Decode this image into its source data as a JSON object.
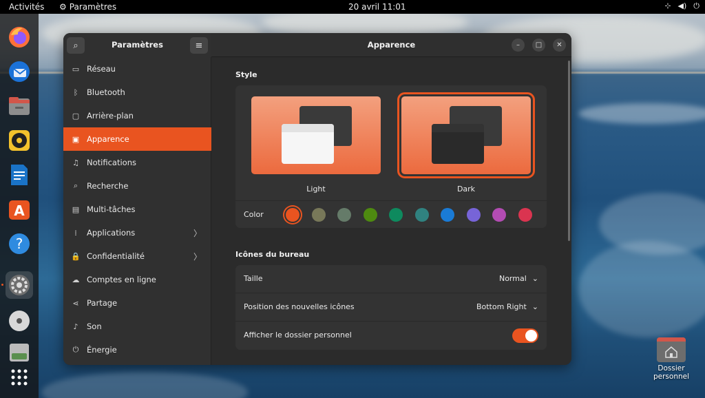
{
  "topbar": {
    "activities": "Activités",
    "app_name": "Paramètres",
    "clock": "20 avril  11:01"
  },
  "dock": {
    "items": [
      "firefox-icon",
      "thunderbird-icon",
      "files-icon",
      "rhythmbox-icon",
      "writer-icon",
      "app-center-icon",
      "help-icon",
      "settings-icon",
      "disc-icon",
      "drive-icon",
      "app-grid-icon"
    ]
  },
  "window": {
    "sidebar_title": "Paramètres",
    "main_title": "Apparence",
    "nav": [
      {
        "label": "Réseau",
        "icon": "network-icon",
        "glyph": "▭",
        "chevron": ""
      },
      {
        "label": "Bluetooth",
        "icon": "bluetooth-icon",
        "glyph": "ᛒ",
        "chevron": ""
      },
      {
        "label": "Arrière-plan",
        "icon": "background-icon",
        "glyph": "▢",
        "chevron": ""
      },
      {
        "label": "Apparence",
        "icon": "appearance-icon",
        "glyph": "▣",
        "chevron": ""
      },
      {
        "label": "Notifications",
        "icon": "bell-icon",
        "glyph": "♫",
        "chevron": ""
      },
      {
        "label": "Recherche",
        "icon": "search-icon",
        "glyph": "⌕",
        "chevron": ""
      },
      {
        "label": "Multi-tâches",
        "icon": "multitask-icon",
        "glyph": "▤",
        "chevron": ""
      },
      {
        "label": "Applications",
        "icon": "apps-icon",
        "glyph": "⁞",
        "chevron": "〉"
      },
      {
        "label": "Confidentialité",
        "icon": "lock-icon",
        "glyph": "🔒",
        "chevron": "〉"
      },
      {
        "label": "Comptes en ligne",
        "icon": "cloud-icon",
        "glyph": "☁",
        "chevron": ""
      },
      {
        "label": "Partage",
        "icon": "share-icon",
        "glyph": "⋖",
        "chevron": ""
      },
      {
        "label": "Son",
        "icon": "music-icon",
        "glyph": "♪",
        "chevron": ""
      },
      {
        "label": "Énergie",
        "icon": "power-icon",
        "glyph": "⏻",
        "chevron": ""
      }
    ],
    "selected_index": 3
  },
  "appearance": {
    "style_title": "Style",
    "styles": [
      {
        "label": "Light",
        "selected": false
      },
      {
        "label": "Dark",
        "selected": true
      }
    ],
    "color_label": "Color",
    "colors": [
      "#e95420",
      "#787859",
      "#657b69",
      "#4e8a10",
      "#0e8a5e",
      "#308280",
      "#1a7bd6",
      "#7764d8",
      "#b34cb3",
      "#da3450"
    ],
    "selected_color_index": 0,
    "desktop_icons_title": "Icônes du bureau",
    "rows": {
      "size_label": "Taille",
      "size_value": "Normal",
      "position_label": "Position des nouvelles icônes",
      "position_value": "Bottom Right",
      "home_label": "Afficher le dossier personnel",
      "home_enabled": true
    }
  },
  "desktop": {
    "home_folder_label_line1": "Dossier",
    "home_folder_label_line2": "personnel"
  },
  "colors": {
    "accent": "#e95420",
    "sidebar_bg": "#303030",
    "main_bg": "#2b2b2b"
  }
}
